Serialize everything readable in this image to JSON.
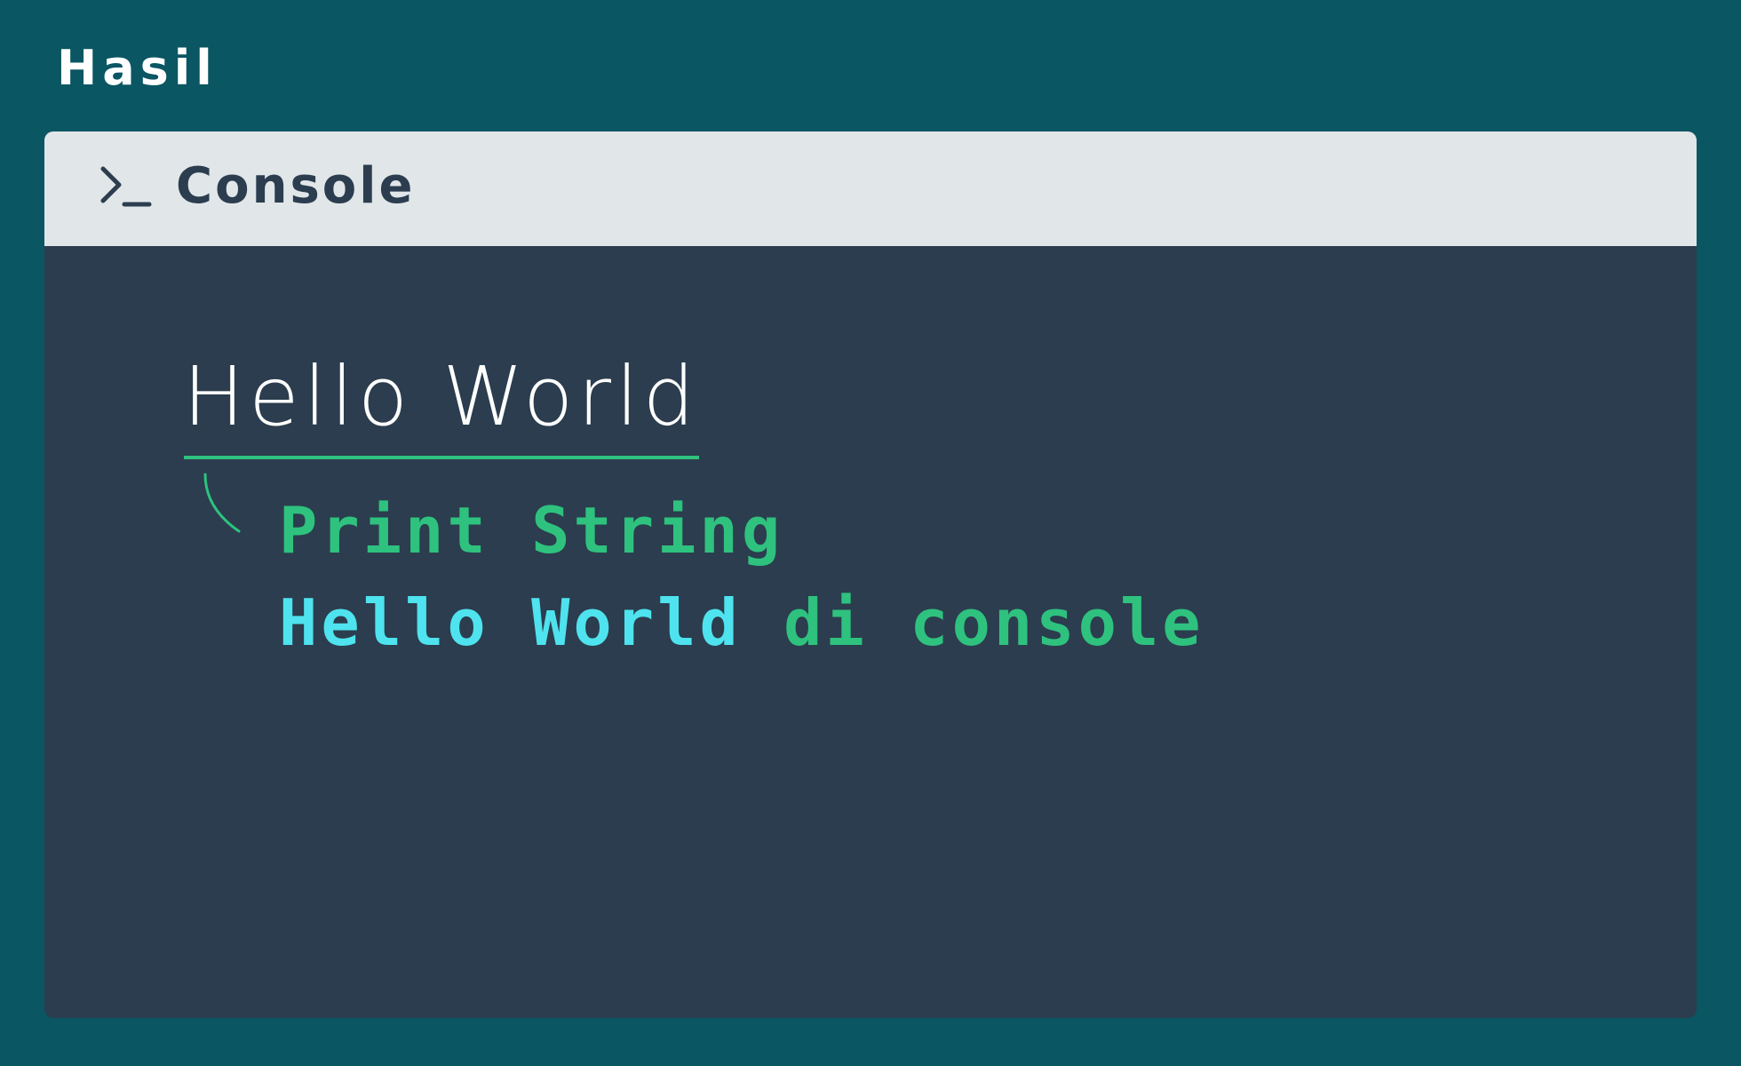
{
  "section": {
    "title": "Hasil"
  },
  "console": {
    "icon": "terminal-prompt-icon",
    "label": "Console",
    "output": "Hello World"
  },
  "annotation": {
    "title": "Print String",
    "description_highlight": "Hello World",
    "description_rest": " di console"
  },
  "colors": {
    "page_background": "#0a5663",
    "console_header": "#e1e6e9",
    "console_body": "#2b3d4e",
    "accent_green": "#2ec27e",
    "accent_cyan": "#4ee3ee",
    "output_text": "#ffffff"
  }
}
